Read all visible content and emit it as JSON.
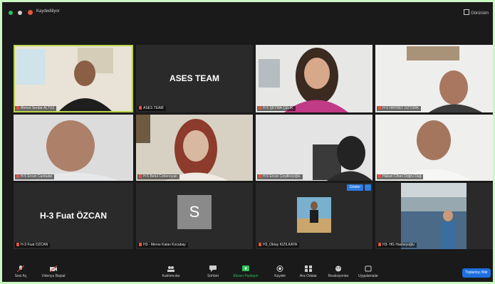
{
  "window": {
    "recording_label": "Kaydediliyor",
    "view_label": "Görünüm"
  },
  "tiles": [
    {
      "id": "t1",
      "name": "Ahmet Serdar ALTÜZ",
      "kind": "video",
      "active": true
    },
    {
      "id": "t2",
      "name": "ASES TEAM",
      "kind": "text",
      "display": "ASES TEAM"
    },
    {
      "id": "t3",
      "name": "H-5 ŞEYMA ÇELİK",
      "kind": "video"
    },
    {
      "id": "t4",
      "name": "H-5 HAYRET ÖZTÜRK",
      "kind": "video"
    },
    {
      "id": "t5",
      "name": "H-5 Ercan Canbulat",
      "kind": "video"
    },
    {
      "id": "t6",
      "name": "H-5 Betül Cebenoyan",
      "kind": "video"
    },
    {
      "id": "t7",
      "name": "H-5 Ercan Çeşitkoçoğlu",
      "kind": "video"
    },
    {
      "id": "t8",
      "name": "Hakan Cihan Doğru Dağ",
      "kind": "video"
    },
    {
      "id": "t9",
      "name": "H-3 Fuat ÖZCAN",
      "kind": "text",
      "display": "H-3 Fuat ÖZCAN"
    },
    {
      "id": "t10",
      "name": "H3 - Merve Kalan Kocabay",
      "kind": "avatar",
      "initial": "S"
    },
    {
      "id": "t11",
      "name": "H3_Oktay KIZILKAYA",
      "kind": "photo"
    },
    {
      "id": "t12",
      "name": "H3- HG Hasbeyoğlu",
      "kind": "photo"
    }
  ],
  "see_button": "Göster",
  "toolbar": {
    "items": [
      {
        "label": "Sesi Aç",
        "icon": "microphone-icon"
      },
      {
        "label": "Videoyu Başlat",
        "icon": "video-camera-icon"
      },
      {
        "label": "Katılımcılar",
        "icon": "participants-icon"
      },
      {
        "label": "Sohbet",
        "icon": "chat-icon"
      },
      {
        "label": "Ekranı Paylaşın",
        "icon": "share-screen-icon"
      },
      {
        "label": "Kaydet",
        "icon": "record-icon"
      },
      {
        "label": "Ara Odalar",
        "icon": "breakout-rooms-icon"
      },
      {
        "label": "Reaksiyonlar",
        "icon": "reactions-icon"
      },
      {
        "label": "Uygulamalar",
        "icon": "apps-icon"
      }
    ],
    "end_label": "Toplantıyı Bitir"
  },
  "colors": {
    "accent": "#1e6fe0",
    "active_border": "#b9d54a",
    "share_green": "#2ec15a",
    "mic_off": "#e8553e"
  }
}
